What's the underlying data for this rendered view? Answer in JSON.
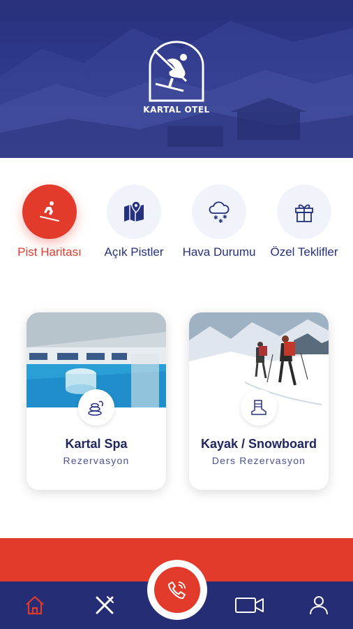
{
  "header": {
    "brand": "KARTAL OTEL"
  },
  "quick_actions": [
    {
      "label": "Pist Haritası",
      "icon": "skier-icon",
      "active": true
    },
    {
      "label": "Açık Pistler",
      "icon": "map-pin-icon",
      "active": false
    },
    {
      "label": "Hava Durumu",
      "icon": "snow-cloud-icon",
      "active": false
    },
    {
      "label": "Özel Teklifler",
      "icon": "gift-icon",
      "active": false
    }
  ],
  "cards": [
    {
      "title": "Kartal Spa",
      "subtitle": "Rezervasyon",
      "icon": "spa-stones-icon"
    },
    {
      "title": "Kayak / Snowboard",
      "subtitle": "Ders Rezervasyon",
      "icon": "ski-boot-icon"
    }
  ],
  "bottom_nav": {
    "items": [
      "home-icon",
      "fork-knife-icon",
      "phone-call-icon",
      "video-camera-icon",
      "user-icon"
    ],
    "active": "home-icon"
  },
  "colors": {
    "navy": "#252d74",
    "accent_red": "#e23a2b",
    "light_circle": "#f1f3fb"
  }
}
